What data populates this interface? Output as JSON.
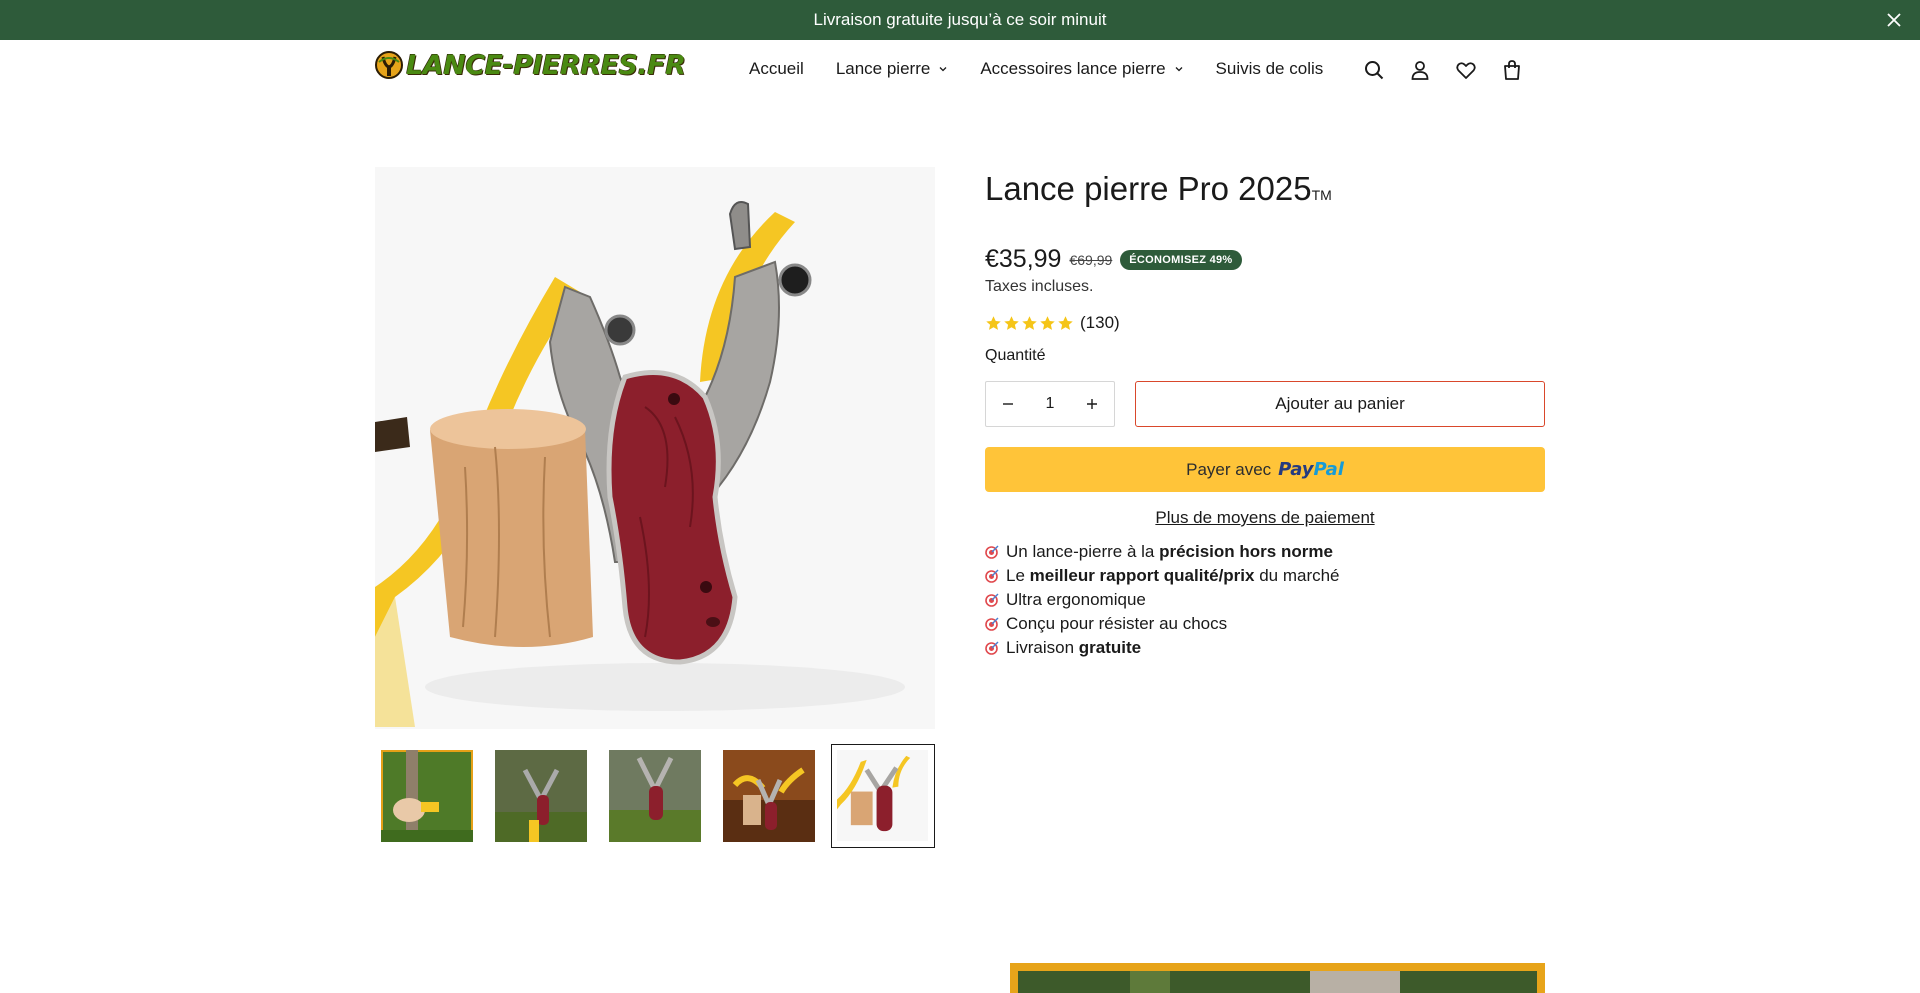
{
  "announcement": {
    "text": "Livraison gratuite jusqu’à ce soir minuit",
    "close_icon": "close-icon"
  },
  "header": {
    "logo_text": "LANCE-PIERRES.FR",
    "nav": [
      {
        "label": "Accueil",
        "has_dropdown": false
      },
      {
        "label": "Lance pierre",
        "has_dropdown": true
      },
      {
        "label": "Accessoires lance pierre",
        "has_dropdown": true
      },
      {
        "label": "Suivis de colis",
        "has_dropdown": false
      }
    ],
    "icons": [
      "search-icon",
      "account-icon",
      "wishlist-icon",
      "cart-icon"
    ]
  },
  "product": {
    "title": "Lance pierre Pro 2025",
    "title_mark": "TM",
    "price": "€35,99",
    "compare_price": "€69,99",
    "save_badge": "ÉCONOMISEZ 49%",
    "tax_note": "Taxes incluses.",
    "rating": 5,
    "rating_count": "(130)",
    "quantity_label": "Quantité",
    "quantity_value": "1",
    "add_to_cart": "Ajouter au panier",
    "paypal_prefix": "Payer avec",
    "paypal_brand_1": "Pay",
    "paypal_brand_2": "Pal",
    "more_payment": "Plus de moyens de paiement",
    "features": [
      {
        "before": "Un lance-pierre à la ",
        "bold": "précision hors norme",
        "after": ""
      },
      {
        "before": "Le ",
        "bold": "meilleur rapport qualité/prix",
        "after": " du marché"
      },
      {
        "before": "Ultra ergonomique",
        "bold": "",
        "after": ""
      },
      {
        "before": "Conçu pour résister au chocs",
        "bold": "",
        "after": ""
      },
      {
        "before": "Livraison ",
        "bold": "gratuite",
        "after": ""
      }
    ],
    "thumbnails": 5,
    "active_thumbnail": 5
  },
  "colors": {
    "announcement_bg": "#2e5b3a",
    "badge_bg": "#2e5b3a",
    "add_to_cart_border": "#d9472b",
    "paypal_bg": "#ffc439",
    "star": "#f5c518"
  }
}
